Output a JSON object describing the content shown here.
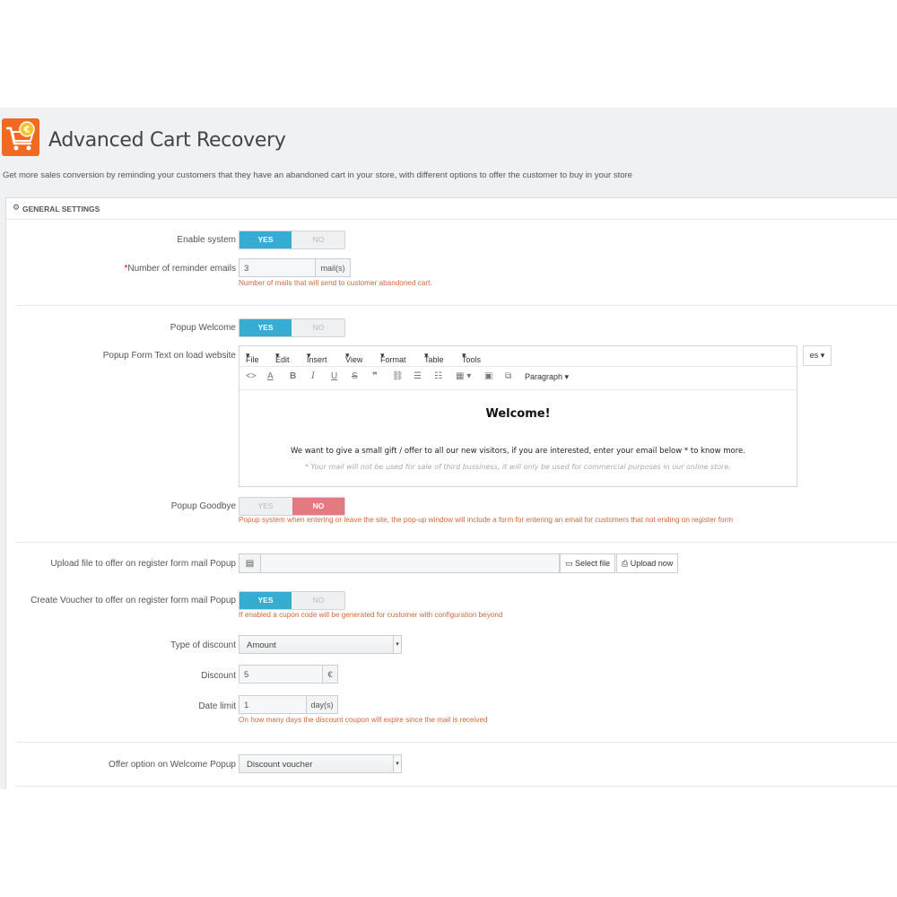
{
  "header": {
    "title": "Advanced Cart Recovery",
    "logo_icon": "cart-euro-icon",
    "subtitle": "Get more sales conversion by reminding your customers that they have an abandoned cart in your store, with different options to offer the customer to buy in your store"
  },
  "panel": {
    "heading": "GENERAL SETTINGS",
    "heading_icon": "gear-icon"
  },
  "switch_labels": {
    "yes": "YES",
    "no": "NO"
  },
  "fields": {
    "enable_system": {
      "label": "Enable system",
      "value": "YES"
    },
    "reminder_emails": {
      "required_mark": "*",
      "label": "Number of reminder emails",
      "value": "3",
      "suffix": "mail(s)",
      "help": "Number of mails that will send to customer abandoned cart."
    },
    "popup_welcome": {
      "label": "Popup Welcome",
      "value": "YES"
    },
    "popup_form_text": {
      "label": "Popup Form Text on load website",
      "language": "es"
    },
    "popup_goodbye": {
      "label": "Popup Goodbye",
      "value": "NO",
      "help": "Popup system when entering or leave the site, the pop-up window will include a form for entering an email for customers that not ending on register form"
    },
    "upload_file": {
      "label": "Upload file to offer on register form mail Popup",
      "select_label": "Select file",
      "upload_label": "Upload now"
    },
    "create_voucher": {
      "label": "Create Voucher to offer on register form mail Popup",
      "value": "YES",
      "help": "If enabled a cupon code will be generated for customer with configuration beyond"
    },
    "type_of_discount": {
      "label": "Type of discount",
      "value": "Amount"
    },
    "discount": {
      "label": "Discount",
      "value": "5",
      "suffix": "€"
    },
    "date_limit": {
      "label": "Date limit",
      "value": "1",
      "suffix": "day(s)",
      "help": "On how many days the discount coupon will expire since the mail is received"
    },
    "offer_option": {
      "label": "Offer option on Welcome Popup",
      "value": "Discount voucher"
    }
  },
  "editor": {
    "menus": [
      "File",
      "Edit",
      "Insert",
      "View",
      "Format",
      "Table",
      "Tools"
    ],
    "block_format": "Paragraph",
    "content": {
      "heading": "Welcome!",
      "paragraph": "We want to give a small gift / offer to all our new visitors, if you are interested, enter your email below * to know more.",
      "note": "* Your mail will not be used for sale of third bussiness, it will only be used for commercial purposes in our online store."
    }
  },
  "colors": {
    "yes_active": "#35acd2",
    "no_active": "#e37a80",
    "help_text": "#d0693b",
    "logo": "#f26a22"
  }
}
